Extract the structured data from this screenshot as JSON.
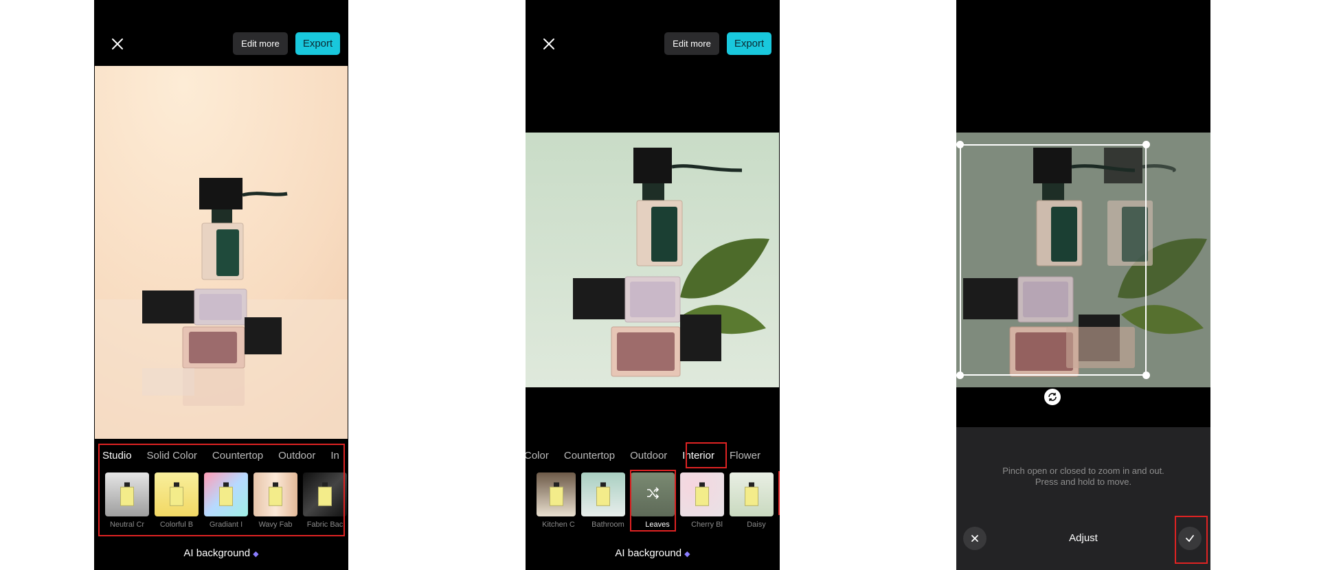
{
  "screens": [
    {
      "top_bar": {
        "edit_more_label": "Edit more",
        "export_label": "Export"
      },
      "categories": [
        "Studio",
        "Solid Color",
        "Countertop",
        "Outdoor",
        "In"
      ],
      "active_category": "Studio",
      "thumbnails": [
        {
          "label": "Neutral Cr"
        },
        {
          "label": "Colorful B"
        },
        {
          "label": "Gradiant I"
        },
        {
          "label": "Wavy Fab"
        },
        {
          "label": "Fabric Bac"
        }
      ],
      "footer_label": "AI background"
    },
    {
      "top_bar": {
        "edit_more_label": "Edit more",
        "export_label": "Export"
      },
      "categories": [
        "Color",
        "Countertop",
        "Outdoor",
        "Interior",
        "Flower"
      ],
      "active_category": "Interior",
      "thumbnails": [
        {
          "label": "Kitchen C"
        },
        {
          "label": "Bathroom"
        },
        {
          "label": "Leaves"
        },
        {
          "label": "Cherry Bl"
        },
        {
          "label": "Daisy"
        }
      ],
      "selected_thumbnail": "Leaves",
      "footer_label": "AI background"
    },
    {
      "hint_text": "Pinch open or closed to zoom in and out. Press and hold to move.",
      "bottom_bar": {
        "title": "Adjust"
      }
    }
  ],
  "colors": {
    "accent": "#19c8dd",
    "highlight_box": "#e02323",
    "premium_gem": "#8a7dff"
  }
}
